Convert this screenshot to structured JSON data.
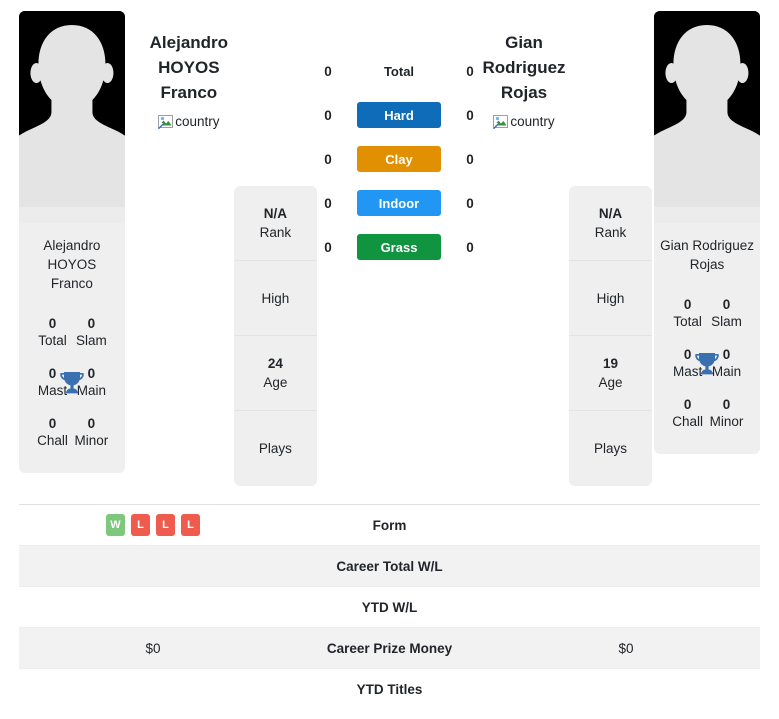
{
  "players": {
    "left": {
      "display_name_line1": "Alejandro",
      "display_name_line2": "HOYOS Franco",
      "full_name": "Alejandro HOYOS Franco",
      "country_alt": "country",
      "titles": {
        "total_value": "0",
        "total_label": "Total",
        "slam_value": "0",
        "slam_label": "Slam",
        "mast_value": "0",
        "mast_label": "Mast",
        "main_value": "0",
        "main_label": "Main",
        "chall_value": "0",
        "chall_label": "Chall",
        "minor_value": "0",
        "minor_label": "Minor"
      },
      "info": {
        "rank_value": "N/A",
        "rank_label": "Rank",
        "high_value": "",
        "high_label": "High",
        "age_value": "24",
        "age_label": "Age",
        "plays_value": "",
        "plays_label": "Plays"
      },
      "surfaces": {
        "total": "0",
        "hard": "0",
        "clay": "0",
        "indoor": "0",
        "grass": "0"
      },
      "table_values": {
        "form": [
          "W",
          "L",
          "L",
          "L"
        ],
        "career_total_wl": "",
        "ytd_wl": "",
        "career_prize_money": "$0",
        "ytd_titles": ""
      }
    },
    "right": {
      "display_name_line1": "Gian",
      "display_name_line2": "Rodriguez",
      "display_name_line3": "Rojas",
      "full_name": "Gian Rodriguez Rojas",
      "country_alt": "country",
      "titles": {
        "total_value": "0",
        "total_label": "Total",
        "slam_value": "0",
        "slam_label": "Slam",
        "mast_value": "0",
        "mast_label": "Mast",
        "main_value": "0",
        "main_label": "Main",
        "chall_value": "0",
        "chall_label": "Chall",
        "minor_value": "0",
        "minor_label": "Minor"
      },
      "info": {
        "rank_value": "N/A",
        "rank_label": "Rank",
        "high_value": "",
        "high_label": "High",
        "age_value": "19",
        "age_label": "Age",
        "plays_value": "",
        "plays_label": "Plays"
      },
      "surfaces": {
        "total": "0",
        "hard": "0",
        "clay": "0",
        "indoor": "0",
        "grass": "0"
      },
      "table_values": {
        "form": [],
        "career_total_wl": "",
        "ytd_wl": "",
        "career_prize_money": "$0",
        "ytd_titles": ""
      }
    }
  },
  "surface_labels": {
    "total": "Total",
    "hard": "Hard",
    "clay": "Clay",
    "indoor": "Indoor",
    "grass": "Grass"
  },
  "surface_colors": {
    "total": "transparent",
    "hard": "#0f6cb8",
    "clay": "#e09000",
    "indoor": "#2196f3",
    "grass": "#109440"
  },
  "table_rows": {
    "form": "Form",
    "career_total_wl": "Career Total W/L",
    "ytd_wl": "YTD W/L",
    "career_prize_money": "Career Prize Money",
    "ytd_titles": "YTD Titles"
  },
  "form_colors": {
    "win": "#7dc87d",
    "loss": "#ef5b4c"
  },
  "theme": {
    "card_bg": "#efefef",
    "alt_row_bg": "#f2f2f2",
    "trophy_color": "#3a6fb0",
    "photo_bg": "#000000"
  }
}
